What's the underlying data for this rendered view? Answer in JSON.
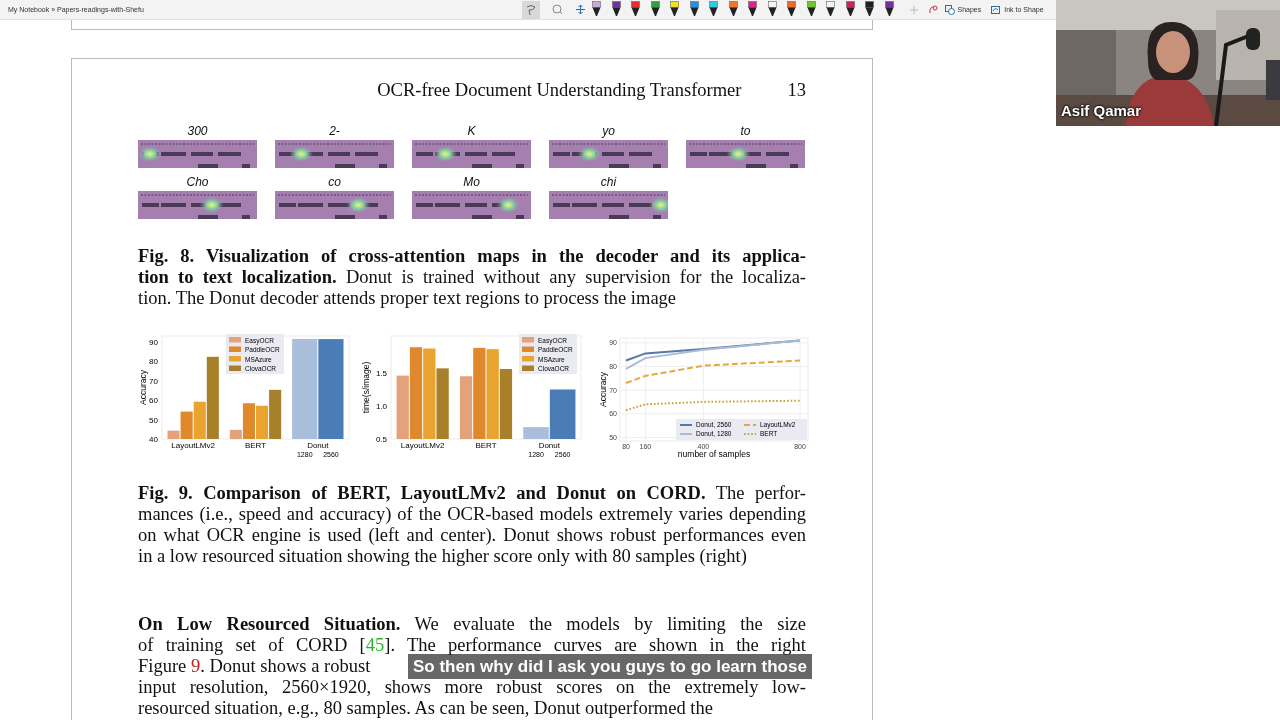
{
  "app": {
    "breadcrumb": "My Notebook » Papers-readings-with-Shefu"
  },
  "toolbar": {
    "pens": [
      {
        "color": "#c9a8dc"
      },
      {
        "color": "#7030a0"
      },
      {
        "color": "#e03030"
      },
      {
        "color": "#30a040"
      },
      {
        "color": "#f0e020"
      },
      {
        "color": "#2a8ee0"
      },
      {
        "color": "#30c8e8"
      },
      {
        "color": "#f07828"
      },
      {
        "color": "#e0208c"
      },
      {
        "color": "#f4f4f4"
      },
      {
        "color": "#f06828"
      },
      {
        "color": "#70c828"
      },
      {
        "color": "#f4f4f4"
      },
      {
        "color": "#d02060"
      },
      {
        "color": "#202020"
      },
      {
        "color": "#7030a0"
      }
    ],
    "buttons": [
      {
        "label": "Shapes",
        "kind": "shapes"
      },
      {
        "label": "Ink to Shape",
        "kind": "ink"
      }
    ]
  },
  "page": {
    "running_title": "OCR-free Document Understanding Transformer",
    "page_number": "13",
    "figure8": {
      "maps": [
        {
          "token": "300"
        },
        {
          "token": "2-"
        },
        {
          "token": "K"
        },
        {
          "token": "yo"
        },
        {
          "token": "to"
        },
        {
          "token": "Cho"
        },
        {
          "token": "co"
        },
        {
          "token": "Mo"
        },
        {
          "token": "chi"
        }
      ],
      "caption": {
        "lines": [
          [
            {
              "text": "Fig. 8. Visualization of cross-attention maps in the decoder and its applica-",
              "kind": "bold"
            }
          ],
          [
            {
              "text": "tion to text localization.",
              "kind": "bold"
            },
            {
              "text": " Donut is trained without any supervision for the localiza-"
            }
          ],
          [
            {
              "text": "tion. The Donut decoder attends proper text regions to process the image"
            }
          ]
        ]
      }
    },
    "figure9": {
      "charts": [
        {
          "chart_data": {
            "type": "bar",
            "ylabel": "Accuracy",
            "categories": [
              "LayoutLMv2",
              "BERT",
              "Donut"
            ],
            "ylim": [
              40,
              93
            ],
            "yticks": [
              40,
              50,
              60,
              70,
              80,
              90
            ],
            "legend": true,
            "series": [
              {
                "name": "EasyOCR",
                "color": "#e3a27c",
                "values": [
                  44.3,
                  44.7,
                  null
                ]
              },
              {
                "name": "PaddleOCR",
                "color": "#e0882c",
                "values": [
                  54.1,
                  58.4,
                  null
                ]
              },
              {
                "name": "MSAzure",
                "color": "#e8a42e",
                "values": [
                  59.2,
                  57.1,
                  null
                ]
              },
              {
                "name": "ClovaOCR",
                "color": "#a8802a",
                "values": [
                  82.3,
                  65.3,
                  null
                ]
              },
              {
                "name": "1280",
                "color": "#a9bedb",
                "values": [
                  null,
                  null,
                  91.5
                ]
              },
              {
                "name": "2560",
                "color": "#4a7db5",
                "values": [
                  null,
                  null,
                  91.4
                ]
              }
            ]
          }
        },
        {
          "chart_data": {
            "type": "bar",
            "ylabel": "time(s/image)",
            "categories": [
              "LayoutLMv2",
              "BERT",
              "Donut"
            ],
            "ylim": [
              0.5,
              2.06
            ],
            "yticks": [
              {
                "value": 0.5,
                "label": "0.5"
              },
              {
                "value": 1,
                "label": "1.0"
              },
              {
                "value": 1.5,
                "label": "1.5"
              }
            ],
            "legend": true,
            "series": [
              {
                "name": "EasyOCR",
                "color": "#e3a27c",
                "values": [
                  1.46,
                  1.45,
                  null
                ]
              },
              {
                "name": "PaddleOCR",
                "color": "#e0882c",
                "values": [
                  1.89,
                  1.88,
                  null
                ]
              },
              {
                "name": "MSAzure",
                "color": "#e8a42e",
                "values": [
                  1.87,
                  1.86,
                  null
                ]
              },
              {
                "name": "ClovaOCR",
                "color": "#a8802a",
                "values": [
                  1.57,
                  1.56,
                  null
                ]
              },
              {
                "name": "1280",
                "color": "#a9bedb",
                "values": [
                  null,
                  null,
                  0.68
                ]
              },
              {
                "name": "2560",
                "color": "#4a7db5",
                "values": [
                  null,
                  null,
                  1.25
                ]
              }
            ]
          }
        },
        {
          "chart_data": {
            "type": "line",
            "xlabel": "number of samples",
            "ylabel": "Accuracy",
            "x": [
              80,
              160,
              400,
              800
            ],
            "xlim": [
              55,
              833
            ],
            "ylim": [
              48.5,
              92
            ],
            "xticks": [
              80,
              160,
              400,
              800
            ],
            "yticks": [
              50,
              60,
              70,
              80,
              90
            ],
            "grid": true,
            "legend": true,
            "series": [
              {
                "name": "Donut, 2560",
                "color": "#5578a8",
                "line_style": "solid",
                "values": [
                  82.5,
                  85.5,
                  87.3,
                  91
                ]
              },
              {
                "name": "Donut, 1280",
                "color": "#a9bbd6",
                "line_style": "solid",
                "values": [
                  79,
                  83.5,
                  87,
                  91
                ]
              },
              {
                "name": "LayoutLMv2",
                "color": "#e8a838",
                "line_style": "dashed",
                "values": [
                  73,
                  76,
                  80.3,
                  82.5
                ]
              },
              {
                "name": "BERT",
                "color": "#c8a032",
                "line_style": "dotted",
                "values": [
                  61.5,
                  64,
                  65,
                  65.5
                ]
              }
            ]
          }
        }
      ],
      "caption": {
        "lines": [
          [
            {
              "text": "Fig. 9. Comparison of BERT, LayoutLMv2 and Donut on CORD.",
              "kind": "bold"
            },
            {
              "text": " The perfor-"
            }
          ],
          [
            {
              "text": "mances (i.e., speed and accuracy) of the OCR-based models extremely varies depending"
            }
          ],
          [
            {
              "text": "on what OCR engine is used (left and center). Donut shows robust performances even"
            }
          ],
          [
            {
              "text": "in a low resourced situation showing the higher score only with 80 samples (right)"
            }
          ]
        ]
      }
    },
    "section": {
      "lines": [
        [
          {
            "text": "On Low Resourced Situation.",
            "kind": "bold"
          },
          {
            "text": " We evaluate the models by limiting the size"
          }
        ],
        [
          {
            "text": "of training set of CORD ["
          },
          {
            "text": "45",
            "kind": "citation"
          },
          {
            "text": "]. The performance curves are shown in the right"
          }
        ],
        [
          {
            "text": "Figure "
          },
          {
            "text": "9",
            "kind": "figref"
          },
          {
            "text": ". Donut shows a robust"
          }
        ],
        [
          {
            "text": "input resolution, 2560×1920, shows more robust scores on the extremely low-"
          }
        ],
        [
          {
            "text": "resourced situation, e.g., 80 samples. As can be seen, Donut outperformed the"
          }
        ]
      ]
    }
  },
  "video": {
    "name": "Asif Qamar"
  },
  "subtitle": "So then why did I ask you guys to go learn those"
}
